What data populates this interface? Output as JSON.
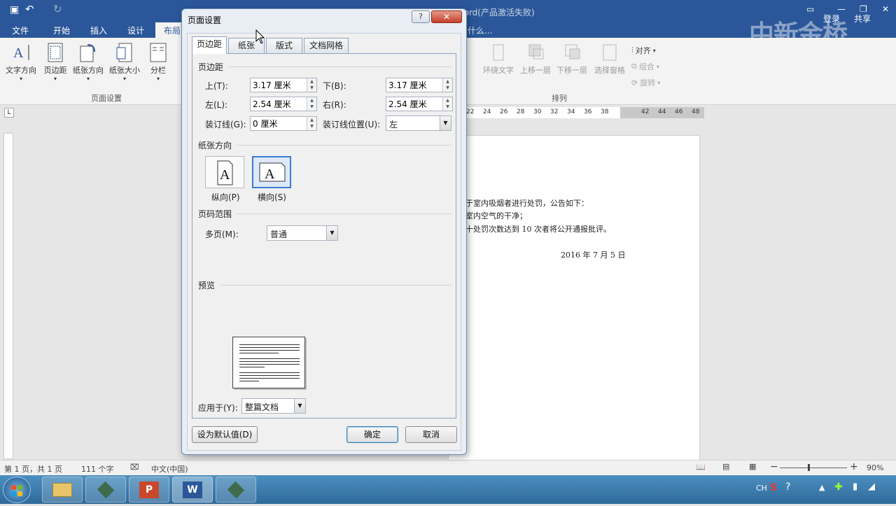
{
  "word": {
    "title": "...Word(产品激活失败)",
    "login": "登录",
    "share": "共享",
    "tell_me": "什么...",
    "watermark": "中新金桥",
    "tabs": [
      "文件",
      "开始",
      "插入",
      "设计",
      "布局"
    ],
    "ribbon_buttons": [
      "文字方向",
      "页边距",
      "纸张方向",
      "纸张大小",
      "分栏"
    ],
    "group_page_setup": "页面设置",
    "arrange_buttons": [
      "环绕文字",
      "上移一层",
      "下移一层",
      "选择窗格"
    ],
    "arrange_small": [
      "对齐",
      "组合",
      "旋转"
    ],
    "group_arrange": "排列",
    "ruler_numbers": [
      "22",
      "24",
      "26",
      "28",
      "30",
      "32",
      "34",
      "36",
      "38",
      "42",
      "44",
      "46",
      "48"
    ],
    "doc_lines": [
      "于室内吸烟者进行处罚，公告如下：",
      "室内空气的干净；",
      "十处罚次数达到 10 次者将公开通报批评。",
      "2016 年 7 月 5 日"
    ],
    "status": {
      "page": "第 1 页，共 1 页",
      "words": "111 个字",
      "lang": "中文(中国)",
      "zoom": "90%"
    },
    "tray_ch": "CH"
  },
  "dialog": {
    "title": "页面设置",
    "help": "?",
    "close": "✕",
    "tabs": [
      "页边距",
      "纸张",
      "版式",
      "文档网格"
    ],
    "margins_section": "页边距",
    "top_label": "上(T):",
    "top_value": "3.17 厘米",
    "bottom_label": "下(B):",
    "bottom_value": "3.17 厘米",
    "left_label": "左(L):",
    "left_value": "2.54 厘米",
    "right_label": "右(R):",
    "right_value": "2.54 厘米",
    "gutter_label": "装订线(G):",
    "gutter_value": "0 厘米",
    "gutter_pos_label": "装订线位置(U):",
    "gutter_pos_value": "左",
    "orientation_section": "纸张方向",
    "portrait": "纵向(P)",
    "landscape": "横向(S)",
    "pages_section": "页码范围",
    "multiple_pages_label": "多页(M):",
    "multiple_pages_value": "普通",
    "preview_section": "预览",
    "apply_to_label": "应用于(Y):",
    "apply_to_value": "整篇文档",
    "set_default": "设为默认值(D)",
    "ok": "确定",
    "cancel": "取消"
  }
}
